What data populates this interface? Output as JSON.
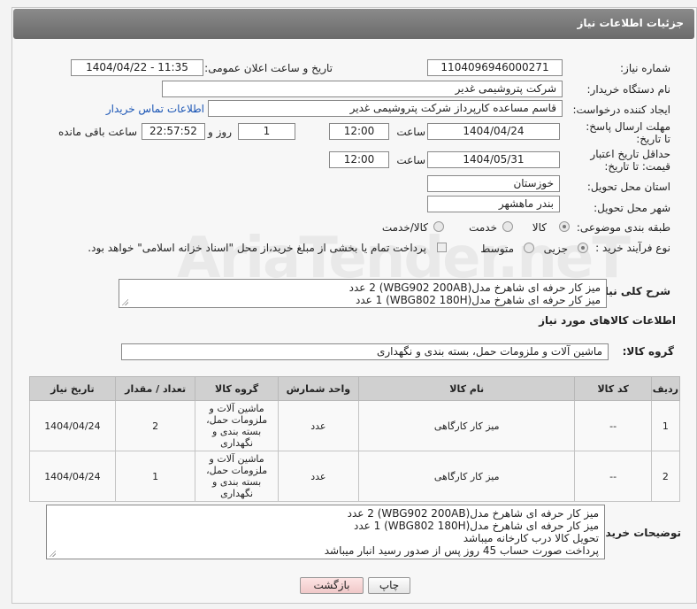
{
  "header": {
    "title": "جزئیات اطلاعات نیاز"
  },
  "watermark": "AriaTender.neT",
  "fields": {
    "need_number_label": "شماره نیاز:",
    "need_number": "1104096946000271",
    "announce_label": "تاریخ و ساعت اعلان عمومی:",
    "announce_value": "1404/04/22 - 11:35",
    "buyer_org_label": "نام دستگاه خریدار:",
    "buyer_org": "شرکت پتروشیمی غدیر",
    "creator_label": "ایجاد کننده درخواست:",
    "creator": "قاسم مساعده کارپرداز شرکت پتروشیمی غدیر",
    "contact_link": "اطلاعات تماس خریدار",
    "reply_deadline_label": "مهلت ارسال پاسخ: تا تاریخ:",
    "reply_date": "1404/04/24",
    "time_label": "ساعت",
    "reply_time": "12:00",
    "days_value": "1",
    "days_label": "روز و",
    "remaining_time": "22:57:52",
    "remaining_label": "ساعت باقی مانده",
    "price_validity_label": "حداقل تاریخ اعتبار قیمت: تا تاریخ:",
    "price_date": "1404/05/31",
    "price_time": "12:00",
    "province_label": "استان محل تحویل:",
    "province": "خوزستان",
    "city_label": "شهر محل تحویل:",
    "city": "بندر ماهشهر",
    "category_label": "طبقه بندی موضوعی:",
    "category_options": [
      "کالا",
      "خدمت",
      "کالا/خدمت"
    ],
    "process_label": "نوع فرآیند خرید :",
    "process_options": [
      "جزیی",
      "متوسط"
    ],
    "payment_note": "پرداخت تمام یا بخشی از مبلغ خرید،از محل \"اسناد خزانه اسلامی\" خواهد بود."
  },
  "description": {
    "label": "شرح کلی نیاز:",
    "lines": [
      "میز کار حرفه ای شاهرخ مدل(WBG902 200AB) 2 عدد",
      "میز کار حرفه ای شاهرخ مدل(WBG802 180H) 1 عدد"
    ]
  },
  "goods_info_title": "اطلاعات کالاهای مورد نیاز",
  "goods_group": {
    "label": "گروه کالا:",
    "value": "ماشین آلات و ملزومات حمل، بسته بندی و نگهداری"
  },
  "table": {
    "headers": [
      "ردیف",
      "کد کالا",
      "نام کالا",
      "واحد شمارش",
      "گروه کالا",
      "تعداد / مقدار",
      "تاریخ نیاز"
    ],
    "rows": [
      {
        "row": "1",
        "code": "--",
        "name": "میز کار کارگاهی",
        "unit": "عدد",
        "group": "ماشین آلات و ملزومات حمل، بسته بندی و نگهداری",
        "qty": "2",
        "date": "1404/04/24"
      },
      {
        "row": "2",
        "code": "--",
        "name": "میز کار کارگاهی",
        "unit": "عدد",
        "group": "ماشین آلات و ملزومات حمل، بسته بندی و نگهداری",
        "qty": "1",
        "date": "1404/04/24"
      }
    ]
  },
  "buyer_notes": {
    "label": "توضیحات خریدار:",
    "lines": [
      "میز کار حرفه ای شاهرخ مدل(WBG902 200AB) 2 عدد",
      "میز کار حرفه ای شاهرخ مدل(WBG802 180H) 1 عدد",
      "تحویل کالا درب کارخانه میباشد",
      "پرداخت صورت حساب 45 روز پس از صدور رسید انبار میباشد"
    ]
  },
  "buttons": {
    "print": "چاپ",
    "back": "بازگشت"
  }
}
